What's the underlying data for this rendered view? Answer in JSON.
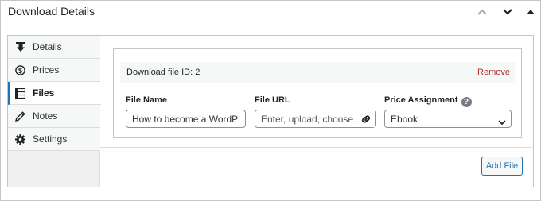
{
  "metabox": {
    "title": "Download Details",
    "controls": [
      "chevron-up-icon",
      "chevron-down-icon",
      "triangle-up-icon"
    ]
  },
  "tabs": [
    {
      "label": "Details",
      "icon": "download-icon",
      "active": false
    },
    {
      "label": "Prices",
      "icon": "dollar-icon",
      "active": false
    },
    {
      "label": "Files",
      "icon": "list-icon",
      "active": true
    },
    {
      "label": "Notes",
      "icon": "pencil-icon",
      "active": false
    },
    {
      "label": "Settings",
      "icon": "gear-icon",
      "active": false
    }
  ],
  "file_row": {
    "title": "Download file ID: 2",
    "remove_label": "Remove",
    "file_name_label": "File Name",
    "file_name_value": "How to become a WordPress",
    "file_url_label": "File URL",
    "file_url_placeholder": "Enter, upload, choose from",
    "price_label": "Price Assignment",
    "price_help": "?",
    "price_value": "Ebook"
  },
  "footer": {
    "add_file_label": "Add File"
  },
  "colors": {
    "accent": "#2271b1",
    "remove": "#b32d2e",
    "border": "#c3c4c7"
  }
}
